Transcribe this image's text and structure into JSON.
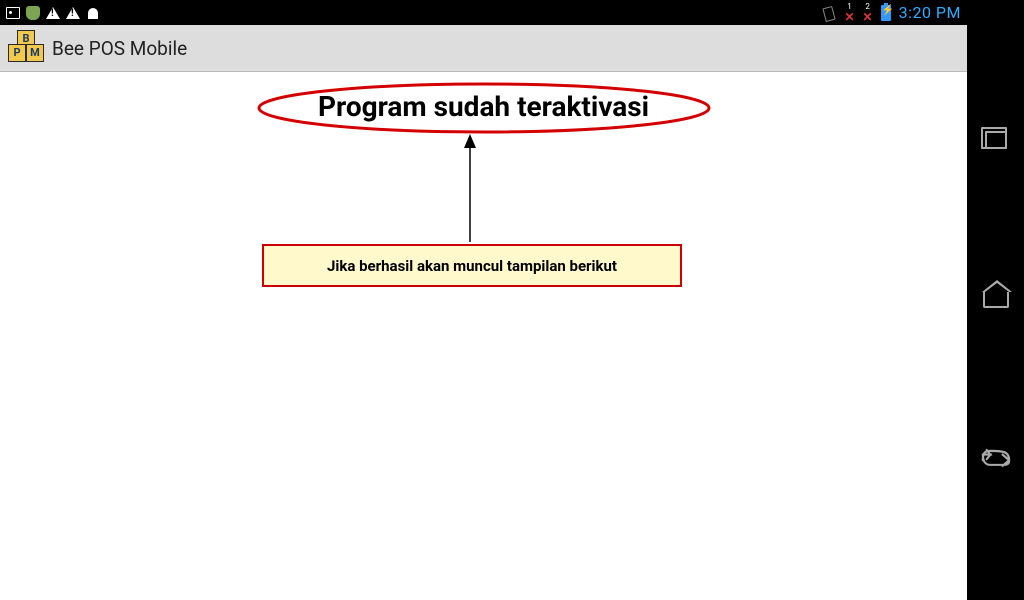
{
  "status": {
    "clock": "3:20 PM",
    "error_indicator_1": "1",
    "error_indicator_2": "2"
  },
  "app": {
    "title": "Bee POS Mobile",
    "logo_letters": {
      "top": "B",
      "left": "P",
      "right": "M"
    }
  },
  "content": {
    "heading": "Program sudah teraktivasi"
  },
  "annotation": {
    "caption": "Jika berhasil akan muncul tampilan berikut"
  }
}
